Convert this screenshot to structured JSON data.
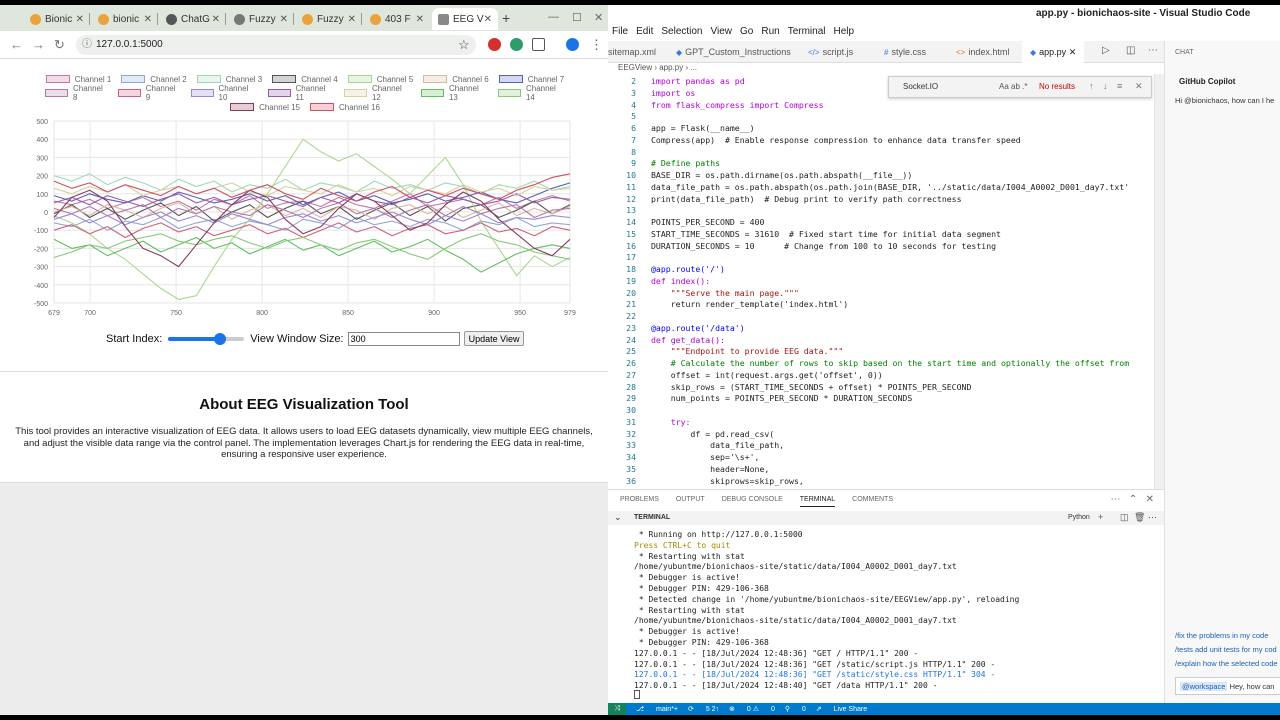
{
  "browser": {
    "tabs": [
      {
        "label": "Bionic",
        "active": false
      },
      {
        "label": "bionic",
        "active": false
      },
      {
        "label": "ChatG",
        "active": false
      },
      {
        "label": "Fuzzy",
        "active": false
      },
      {
        "label": "Fuzzy",
        "active": false
      },
      {
        "label": "403 F",
        "active": false
      },
      {
        "label": "EEG V",
        "active": true
      }
    ],
    "new_tab": "+",
    "url": "127.0.0.1:5000"
  },
  "eeg_page": {
    "legend": [
      {
        "label": "Channel 1",
        "color": "#c678a0"
      },
      {
        "label": "Channel 2",
        "color": "#8fa8d8"
      },
      {
        "label": "Channel 3",
        "color": "#9fd8b8"
      },
      {
        "label": "Channel 4",
        "color": "#555555"
      },
      {
        "label": "Channel 5",
        "color": "#a8d890"
      },
      {
        "label": "Channel 6",
        "color": "#d8b8a0"
      },
      {
        "label": "Channel 7",
        "color": "#5560b8"
      },
      {
        "label": "Channel 8",
        "color": "#b07aa8"
      },
      {
        "label": "Channel 9",
        "color": "#d0607a"
      },
      {
        "label": "Channel 10",
        "color": "#9888d8"
      },
      {
        "label": "Channel 11",
        "color": "#9858b0"
      },
      {
        "label": "Channel 12",
        "color": "#d8d0a0"
      },
      {
        "label": "Channel 13",
        "color": "#60c060"
      },
      {
        "label": "Channel 14",
        "color": "#88c878"
      },
      {
        "label": "Channel 15",
        "color": "#8a3a5a"
      },
      {
        "label": "Channel 16",
        "color": "#d05060"
      }
    ],
    "start_index_label": "Start Index:",
    "start_index_fraction": 0.68,
    "window_size_label": "View Window Size:",
    "window_size_value": "300",
    "update_button": "Update View",
    "about_title": "About EEG Visualization Tool",
    "about_text": "This tool provides an interactive visualization of EEG data. It allows users to load EEG datasets dynamically, view multiple EEG channels, and adjust the visible data range via the control panel. The implementation leverages Chart.js for rendering the EEG data in real-time, ensuring a responsive user experience."
  },
  "chart_data": {
    "type": "line",
    "x_ticks": [
      679,
      700,
      750,
      800,
      850,
      900,
      950,
      979
    ],
    "y_ticks": [
      500,
      400,
      300,
      200,
      100,
      0,
      -100,
      -200,
      -300,
      -400,
      -500
    ],
    "xlim": [
      679,
      979
    ],
    "ylim": [
      -500,
      500
    ],
    "grid": true,
    "legend_position": "top",
    "series": [
      {
        "name": "Channel 1",
        "color": "#c678a0",
        "values": [
          60,
          40,
          70,
          20,
          50,
          80,
          30,
          60,
          10,
          70,
          40,
          90,
          20,
          50,
          60,
          30,
          80,
          40,
          20,
          60,
          100,
          30,
          50,
          70,
          40,
          80,
          20,
          60,
          90,
          60
        ]
      },
      {
        "name": "Channel 2",
        "color": "#8fa8d8",
        "values": [
          -60,
          -80,
          -40,
          -100,
          -50,
          -70,
          -30,
          -90,
          -60,
          -40,
          -80,
          -50,
          -70,
          -100,
          -40,
          -60,
          -90,
          -30,
          -70,
          -50,
          -80,
          -40,
          -60,
          -100,
          -50,
          -70,
          -30,
          -80,
          -60,
          -70
        ]
      },
      {
        "name": "Channel 3",
        "color": "#9fd8b8",
        "values": [
          200,
          170,
          210,
          150,
          190,
          160,
          120,
          180,
          140,
          170,
          110,
          150,
          130,
          180,
          120,
          160,
          140,
          110,
          170,
          130,
          150,
          120,
          160,
          140,
          100,
          150,
          130,
          170,
          120,
          140
        ]
      },
      {
        "name": "Channel 4",
        "color": "#555555",
        "values": [
          -10,
          40,
          -30,
          20,
          -40,
          10,
          50,
          -20,
          30,
          -50,
          0,
          40,
          -30,
          20,
          60,
          -10,
          30,
          -40,
          10,
          50,
          -20,
          30,
          -50,
          20,
          40,
          -30,
          10,
          60,
          -10,
          40
        ]
      },
      {
        "name": "Channel 5",
        "color": "#a8d890",
        "values": [
          -20,
          -60,
          -120,
          -200,
          -260,
          -340,
          -420,
          -480,
          -460,
          -300,
          -150,
          -40,
          100,
          250,
          400,
          330,
          280,
          320,
          250,
          180,
          100,
          200,
          300,
          150,
          -50,
          -200,
          -350,
          -240,
          -300,
          -250
        ]
      },
      {
        "name": "Channel 6",
        "color": "#d8b8a0",
        "values": [
          0,
          30,
          -20,
          40,
          10,
          -30,
          20,
          50,
          -10,
          30,
          -40,
          10,
          40,
          -20,
          20,
          -30,
          30,
          10,
          -40,
          20,
          40,
          -10,
          30,
          -30,
          10,
          50,
          -20,
          20,
          -10,
          30
        ]
      },
      {
        "name": "Channel 7",
        "color": "#5560b8",
        "values": [
          90,
          60,
          100,
          70,
          50,
          90,
          60,
          110,
          80,
          50,
          70,
          100,
          60,
          90,
          40,
          80,
          110,
          60,
          90,
          50,
          70,
          100,
          60,
          80,
          110,
          70,
          50,
          90,
          130,
          160
        ]
      },
      {
        "name": "Channel 8",
        "color": "#b07aa8",
        "values": [
          20,
          -10,
          30,
          -20,
          10,
          40,
          -30,
          20,
          -10,
          30,
          0,
          -20,
          40,
          10,
          -30,
          20,
          50,
          -10,
          20,
          -30,
          10,
          40,
          -20,
          30,
          -10,
          20,
          40,
          -30,
          10,
          20
        ]
      },
      {
        "name": "Channel 9",
        "color": "#d0607a",
        "values": [
          -100,
          -70,
          -120,
          -80,
          -140,
          -90,
          -60,
          -110,
          -80,
          -130,
          -100,
          -70,
          -120,
          -90,
          -140,
          -100,
          -60,
          -110,
          -80,
          -130,
          -90,
          -70,
          -120,
          -100,
          -60,
          -110,
          -90,
          -130,
          -80,
          -100
        ]
      },
      {
        "name": "Channel 10",
        "color": "#9888d8",
        "values": [
          -40,
          -10,
          -60,
          -20,
          -70,
          -30,
          0,
          -50,
          -20,
          -60,
          -10,
          -40,
          -70,
          -30,
          -10,
          -50,
          -20,
          -60,
          -30,
          0,
          -40,
          -70,
          -20,
          -50,
          -10,
          -60,
          -30,
          -40,
          -20,
          -30
        ]
      },
      {
        "name": "Channel 11",
        "color": "#9858b0",
        "values": [
          50,
          80,
          40,
          90,
          60,
          30,
          70,
          100,
          50,
          80,
          40,
          70,
          90,
          60,
          30,
          80,
          50,
          100,
          60,
          40,
          80,
          50,
          90,
          70,
          40,
          60,
          100,
          50,
          80,
          70
        ]
      },
      {
        "name": "Channel 12",
        "color": "#d8d0a0",
        "values": [
          130,
          100,
          140,
          110,
          150,
          90,
          120,
          140,
          100,
          130,
          160,
          110,
          90,
          140,
          120,
          100,
          150,
          110,
          130,
          90,
          140,
          120,
          100,
          150,
          110,
          130,
          90,
          140,
          120,
          130
        ]
      },
      {
        "name": "Channel 13",
        "color": "#60c060",
        "values": [
          -150,
          -200,
          -180,
          -240,
          -200,
          -160,
          -220,
          -180,
          -140,
          -200,
          -170,
          -230,
          -190,
          -150,
          -210,
          -180,
          -240,
          -200,
          -160,
          -220,
          -190,
          -150,
          -210,
          -260,
          -330,
          -280,
          -230,
          -200,
          -180,
          -200
        ]
      },
      {
        "name": "Channel 14",
        "color": "#88c878",
        "values": [
          -250,
          -220,
          -180,
          -200,
          -160,
          -140,
          -120,
          -160,
          -180,
          -150,
          -130,
          -170,
          -200,
          -160,
          -140,
          -180,
          -210,
          -170,
          -150,
          -190,
          -230,
          -260,
          -200,
          -150,
          -120,
          -160,
          -180,
          -220,
          -240,
          -260
        ]
      },
      {
        "name": "Channel 15",
        "color": "#8a3a5a",
        "values": [
          -30,
          80,
          120,
          60,
          -80,
          -200,
          -240,
          -300,
          -180,
          -60,
          40,
          120,
          80,
          -40,
          -120,
          -80,
          20,
          100,
          60,
          -20,
          -100,
          -60,
          40,
          110,
          60,
          -40,
          -120,
          -200,
          -240,
          -150
        ]
      },
      {
        "name": "Channel 16",
        "color": "#d05060",
        "values": [
          170,
          130,
          160,
          110,
          150,
          120,
          90,
          140,
          100,
          130,
          80,
          120,
          150,
          100,
          70,
          130,
          90,
          60,
          110,
          140,
          80,
          120,
          90,
          130,
          100,
          70,
          120,
          150,
          190,
          210
        ]
      }
    ]
  },
  "vscode": {
    "window_title": "app.py - bionichaos-site - Visual Studio Code",
    "menu": [
      "File",
      "Edit",
      "Selection",
      "View",
      "Go",
      "Run",
      "Terminal",
      "Help"
    ],
    "editor_tabs": [
      {
        "label": "sitemap.xml",
        "icon": "xml-icon",
        "active": false
      },
      {
        "label": "GPT_Custom_Instructions",
        "icon": "file-icon",
        "active": false
      },
      {
        "label": "script.js",
        "icon": "js-icon",
        "active": false
      },
      {
        "label": "style.css",
        "icon": "css-icon",
        "active": false
      },
      {
        "label": "index.html",
        "icon": "html-icon",
        "active": false
      },
      {
        "label": "app.py",
        "icon": "python-icon",
        "active": true
      }
    ],
    "breadcrumb": [
      "EEGView",
      "app.py",
      "..."
    ],
    "find": {
      "query": "Socket.IO",
      "options": "Aa  ab  .*",
      "result": "No results"
    },
    "code_lines": [
      {
        "n": "2",
        "kind": "kw",
        "text": "import pandas as pd"
      },
      {
        "n": "3",
        "kind": "kw",
        "text": "import os"
      },
      {
        "n": "4",
        "kind": "kw",
        "text": "from flask_compress import Compress"
      },
      {
        "n": "5",
        "kind": "",
        "text": ""
      },
      {
        "n": "6",
        "kind": "",
        "text": "app = Flask(__name__)"
      },
      {
        "n": "7",
        "kind": "",
        "text": "Compress(app)  # Enable response compression to enhance data transfer speed"
      },
      {
        "n": "8",
        "kind": "",
        "text": ""
      },
      {
        "n": "9",
        "kind": "cm",
        "text": "# Define paths"
      },
      {
        "n": "10",
        "kind": "",
        "text": "BASE_DIR = os.path.dirname(os.path.abspath(__file__))"
      },
      {
        "n": "11",
        "kind": "",
        "text": "data_file_path = os.path.abspath(os.path.join(BASE_DIR, '../static/data/I004_A0002_D001_day7.txt'"
      },
      {
        "n": "12",
        "kind": "",
        "text": "print(data_file_path)  # Debug print to verify path correctness"
      },
      {
        "n": "13",
        "kind": "",
        "text": ""
      },
      {
        "n": "14",
        "kind": "",
        "text": "POINTS_PER_SECOND = 400"
      },
      {
        "n": "15",
        "kind": "",
        "text": "START_TIME_SECONDS = 31610  # Fixed start time for initial data segment"
      },
      {
        "n": "16",
        "kind": "",
        "text": "DURATION_SECONDS = 10      # Change from 100 to 10 seconds for testing"
      },
      {
        "n": "17",
        "kind": "",
        "text": ""
      },
      {
        "n": "18",
        "kind": "dc",
        "text": "@app.route('/')"
      },
      {
        "n": "19",
        "kind": "kw",
        "text": "def index():"
      },
      {
        "n": "20",
        "kind": "st",
        "text": "    \"\"\"Serve the main page.\"\"\""
      },
      {
        "n": "21",
        "kind": "",
        "text": "    return render_template('index.html')"
      },
      {
        "n": "22",
        "kind": "",
        "text": ""
      },
      {
        "n": "23",
        "kind": "dc",
        "text": "@app.route('/data')"
      },
      {
        "n": "24",
        "kind": "kw",
        "text": "def get_data():"
      },
      {
        "n": "25",
        "kind": "st",
        "text": "    \"\"\"Endpoint to provide EEG data.\"\"\""
      },
      {
        "n": "26",
        "kind": "cm",
        "text": "    # Calculate the number of rows to skip based on the start time and optionally the offset from"
      },
      {
        "n": "27",
        "kind": "",
        "text": "    offset = int(request.args.get('offset', 0))"
      },
      {
        "n": "28",
        "kind": "",
        "text": "    skip_rows = (START_TIME_SECONDS + offset) * POINTS_PER_SECOND"
      },
      {
        "n": "29",
        "kind": "",
        "text": "    num_points = POINTS_PER_SECOND * DURATION_SECONDS"
      },
      {
        "n": "30",
        "kind": "",
        "text": ""
      },
      {
        "n": "31",
        "kind": "kw",
        "text": "    try:"
      },
      {
        "n": "32",
        "kind": "",
        "text": "        df = pd.read_csv("
      },
      {
        "n": "33",
        "kind": "",
        "text": "            data_file_path,"
      },
      {
        "n": "34",
        "kind": "",
        "text": "            sep='\\s+',"
      },
      {
        "n": "35",
        "kind": "",
        "text": "            header=None,"
      },
      {
        "n": "36",
        "kind": "",
        "text": "            skiprows=skip_rows,"
      }
    ],
    "panel_tabs": [
      "PROBLEMS",
      "OUTPUT",
      "DEBUG CONSOLE",
      "TERMINAL",
      "COMMENTS"
    ],
    "terminal_header": "TERMINAL",
    "terminal_shell": "Python",
    "terminal_lines": [
      {
        "text": " * Running on http://127.0.0.1:5000",
        "style": ""
      },
      {
        "text": "Press CTRL+C to quit",
        "style": "y"
      },
      {
        "text": " * Restarting with stat",
        "style": ""
      },
      {
        "text": "/home/yubuntme/bionichaos-site/static/data/I004_A0002_D001_day7.txt",
        "style": ""
      },
      {
        "text": " * Debugger is active!",
        "style": ""
      },
      {
        "text": " * Debugger PIN: 429-106-368",
        "style": ""
      },
      {
        "text": " * Detected change in '/home/yubuntme/bionichaos-site/EEGView/app.py', reloading",
        "style": ""
      },
      {
        "text": " * Restarting with stat",
        "style": ""
      },
      {
        "text": "/home/yubuntme/bionichaos-site/static/data/I004_A0002_D001_day7.txt",
        "style": ""
      },
      {
        "text": " * Debugger is active!",
        "style": ""
      },
      {
        "text": " * Debugger PIN: 429-106-368",
        "style": ""
      },
      {
        "text": "127.0.0.1 - - [18/Jul/2024 12:48:36] \"GET / HTTP/1.1\" 200 -",
        "style": ""
      },
      {
        "text": "127.0.0.1 - - [18/Jul/2024 12:48:36] \"GET /static/script.js HTTP/1.1\" 200 -",
        "style": ""
      },
      {
        "text": "127.0.0.1 - - [18/Jul/2024 12:48:36] \"GET /static/style.css HTTP/1.1\" 304 -",
        "style": "b"
      },
      {
        "text": "127.0.0.1 - - [18/Jul/2024 12:48:40] \"GET /data HTTP/1.1\" 200 -",
        "style": ""
      }
    ],
    "chat": {
      "header": "CHAT",
      "copilot": "GitHub Copilot",
      "greeting": "Hi @bionichaos, how can I he",
      "suggestions": [
        "/fix the problems in my code",
        "/tests add unit tests for my cod",
        "/explain how the selected code"
      ],
      "input_tag": "@workspace",
      "input_text": "Hey, how can"
    },
    "status": {
      "branch": "main*+",
      "sync": "5 2↑",
      "errors": "0",
      "warnings": "0",
      "ports": "0",
      "live_share": "Live Share"
    }
  }
}
